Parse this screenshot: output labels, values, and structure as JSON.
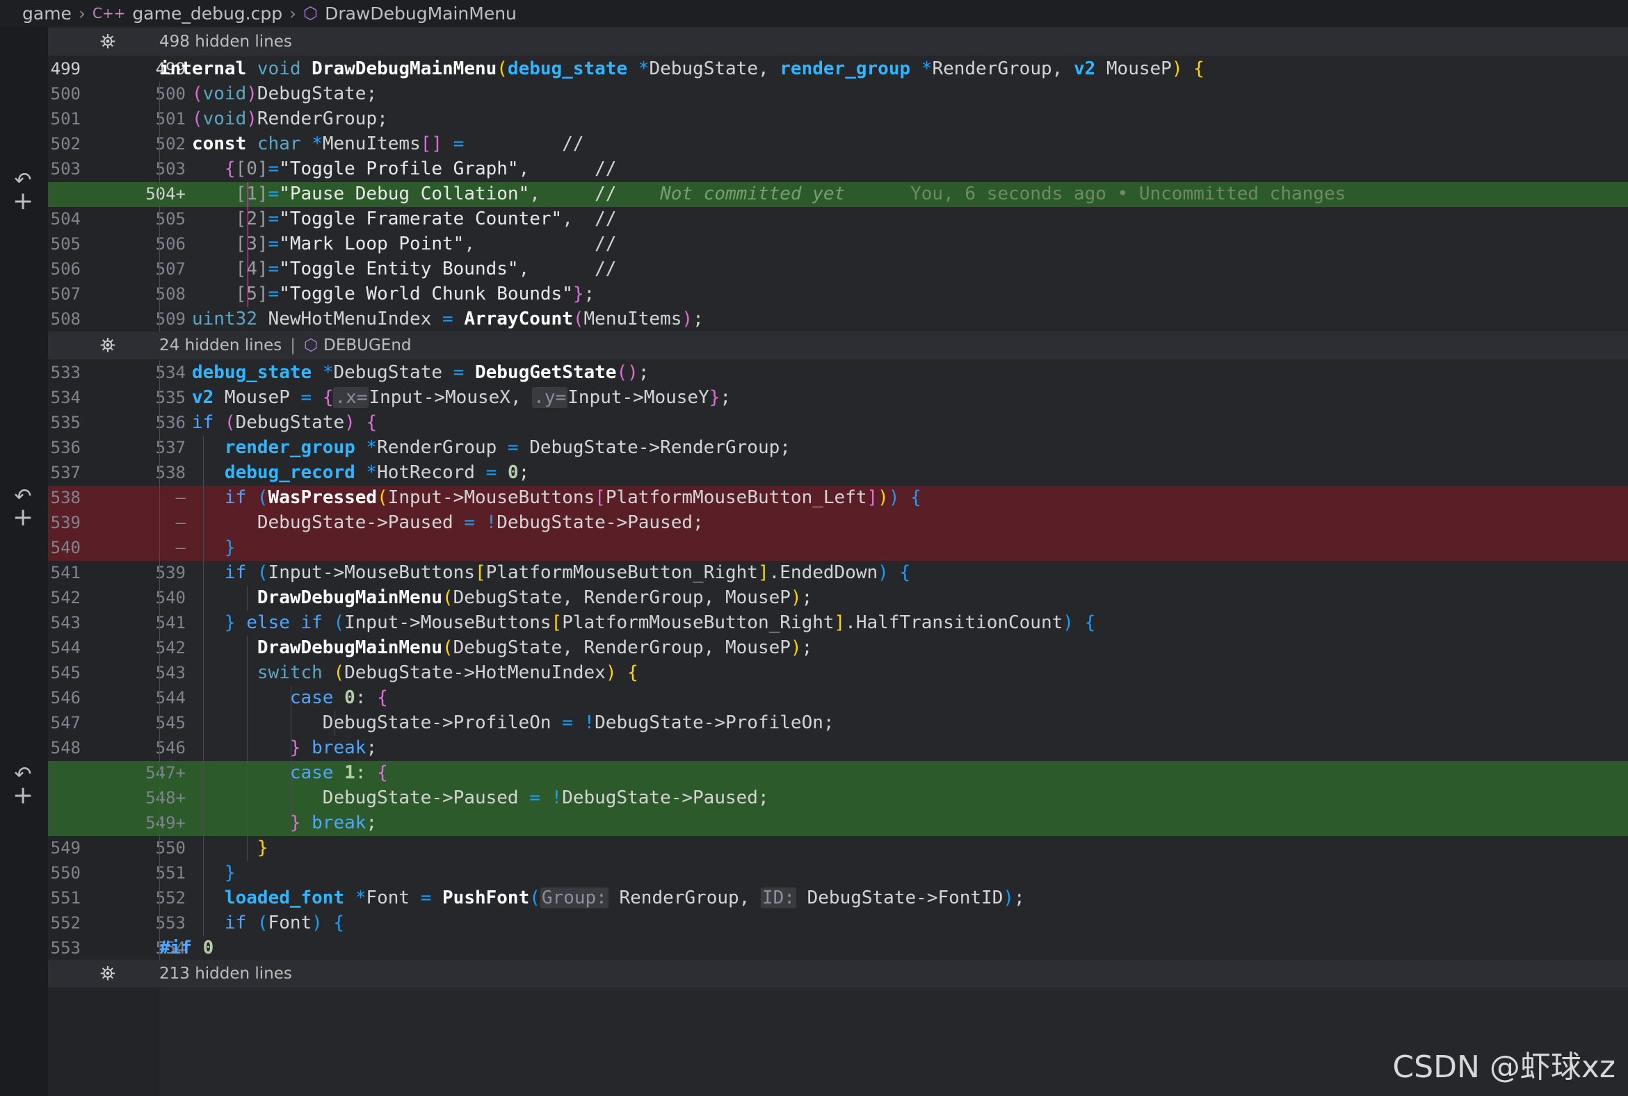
{
  "breadcrumb": {
    "folder": "game",
    "file_icon": "C++",
    "file": "game_debug.cpp",
    "symbol_icon": "cube-icon",
    "symbol": "DrawDebugMainMenu"
  },
  "folds": {
    "top": "498 hidden lines",
    "middle": "24 hidden lines",
    "middle_symbol": "DEBUGEnd",
    "bottom": "213 hidden lines"
  },
  "lines": [
    {
      "old": "499",
      "new": "499"
    },
    {
      "old": "500",
      "new": "500"
    },
    {
      "old": "501",
      "new": "501"
    },
    {
      "old": "502",
      "new": "502"
    },
    {
      "old": "503",
      "new": "503"
    },
    {
      "old": "",
      "new": "504+"
    },
    {
      "old": "504",
      "new": "505"
    },
    {
      "old": "505",
      "new": "506"
    },
    {
      "old": "506",
      "new": "507"
    },
    {
      "old": "507",
      "new": "508"
    },
    {
      "old": "508",
      "new": "509"
    },
    {
      "old": "533",
      "new": "534"
    },
    {
      "old": "534",
      "new": "535"
    },
    {
      "old": "535",
      "new": "536"
    },
    {
      "old": "536",
      "new": "537"
    },
    {
      "old": "537",
      "new": "538"
    },
    {
      "old": "538",
      "new": "—"
    },
    {
      "old": "539",
      "new": "—"
    },
    {
      "old": "540",
      "new": "—"
    },
    {
      "old": "541",
      "new": "539"
    },
    {
      "old": "542",
      "new": "540"
    },
    {
      "old": "543",
      "new": "541"
    },
    {
      "old": "544",
      "new": "542"
    },
    {
      "old": "545",
      "new": "543"
    },
    {
      "old": "546",
      "new": "544"
    },
    {
      "old": "547",
      "new": "545"
    },
    {
      "old": "548",
      "new": "546"
    },
    {
      "old": "",
      "new": "547+"
    },
    {
      "old": "",
      "new": "548+"
    },
    {
      "old": "",
      "new": "549+"
    },
    {
      "old": "549",
      "new": "550"
    },
    {
      "old": "550",
      "new": "551"
    },
    {
      "old": "551",
      "new": "552"
    },
    {
      "old": "552",
      "new": "553"
    },
    {
      "old": "553",
      "new": "554"
    }
  ],
  "blame": {
    "status": "Not committed yet",
    "detail": "You, 6 seconds ago • Uncommitted changes"
  },
  "watermark": "CSDN @虾球xz"
}
